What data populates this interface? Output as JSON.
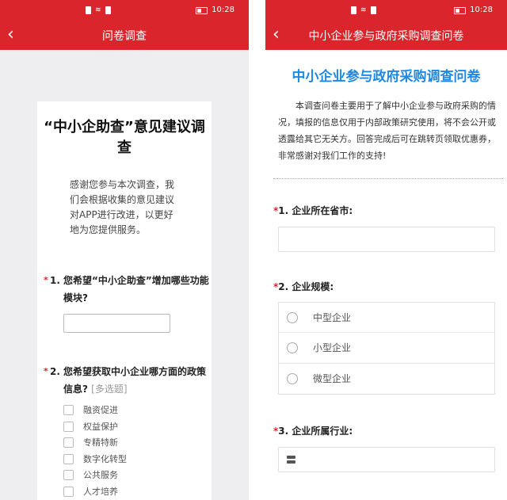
{
  "colors": {
    "brand": "#d9252b",
    "accent": "#1e88e5",
    "page_bg": "#eeeef1"
  },
  "status": {
    "time": "10:28"
  },
  "left": {
    "nav_title": "问卷调查",
    "survey_title": "“中小企助查”意见建议调查",
    "intro": "感谢您参与本次调查，我们会根据收集的意见建议对APP进行改进，以更好地为您提供服务。",
    "q1": {
      "number": "1.",
      "text": "您希望“中小企助查”增加哪些功能模块?"
    },
    "q2": {
      "number": "2.",
      "text": "您希望获取中小企业哪方面的政策信息?",
      "hint": "[多选题]",
      "options": [
        "融资促进",
        "权益保护",
        "专精特新",
        "数字化转型",
        "公共服务",
        "人才培养"
      ]
    }
  },
  "right": {
    "nav_title": "中小企业参与政府采购调查问卷",
    "survey_title": "中小企业参与政府采购调查问卷",
    "intro": "本调查问卷主要用于了解中小企业参与政府采购的情况，填报的信息仅用于内部政策研究使用，将不会公开或透露给其它无关方。回答完成后可在跳转页领取优惠券，非常感谢对我们工作的支持!",
    "q1": {
      "label": "1. 企业所在省市:"
    },
    "q2": {
      "label": "2. 企业规模:",
      "options": [
        "中型企业",
        "小型企业",
        "微型企业"
      ]
    },
    "q3": {
      "label": "3. 企业所属行业:"
    }
  }
}
